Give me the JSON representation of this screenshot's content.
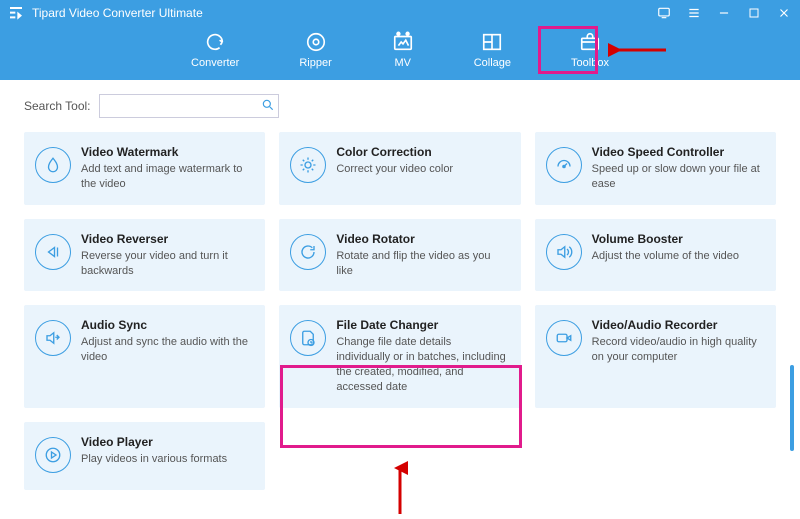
{
  "app": {
    "title": "Tipard Video Converter Ultimate"
  },
  "nav": {
    "converter": "Converter",
    "ripper": "Ripper",
    "mv": "MV",
    "collage": "Collage",
    "toolbox": "Toolbox"
  },
  "search": {
    "label": "Search Tool:",
    "value": ""
  },
  "tools": [
    {
      "title": "Video Watermark",
      "desc": "Add text and image watermark to the video"
    },
    {
      "title": "Color Correction",
      "desc": "Correct your video color"
    },
    {
      "title": "Video Speed Controller",
      "desc": "Speed up or slow down your file at ease"
    },
    {
      "title": "Video Reverser",
      "desc": "Reverse your video and turn it backwards"
    },
    {
      "title": "Video Rotator",
      "desc": "Rotate and flip the video as you like"
    },
    {
      "title": "Volume Booster",
      "desc": "Adjust the volume of the video"
    },
    {
      "title": "Audio Sync",
      "desc": "Adjust and sync the audio with the video"
    },
    {
      "title": "File Date Changer",
      "desc": "Change file date details individually or in batches, including the created, modified, and accessed date"
    },
    {
      "title": "Video/Audio Recorder",
      "desc": "Record video/audio in high quality on your computer"
    },
    {
      "title": "Video Player",
      "desc": "Play videos in various formats"
    }
  ],
  "colors": {
    "accent": "#3c9ee2",
    "highlight": "#e11b8c",
    "card_bg": "#eaf4fc"
  }
}
